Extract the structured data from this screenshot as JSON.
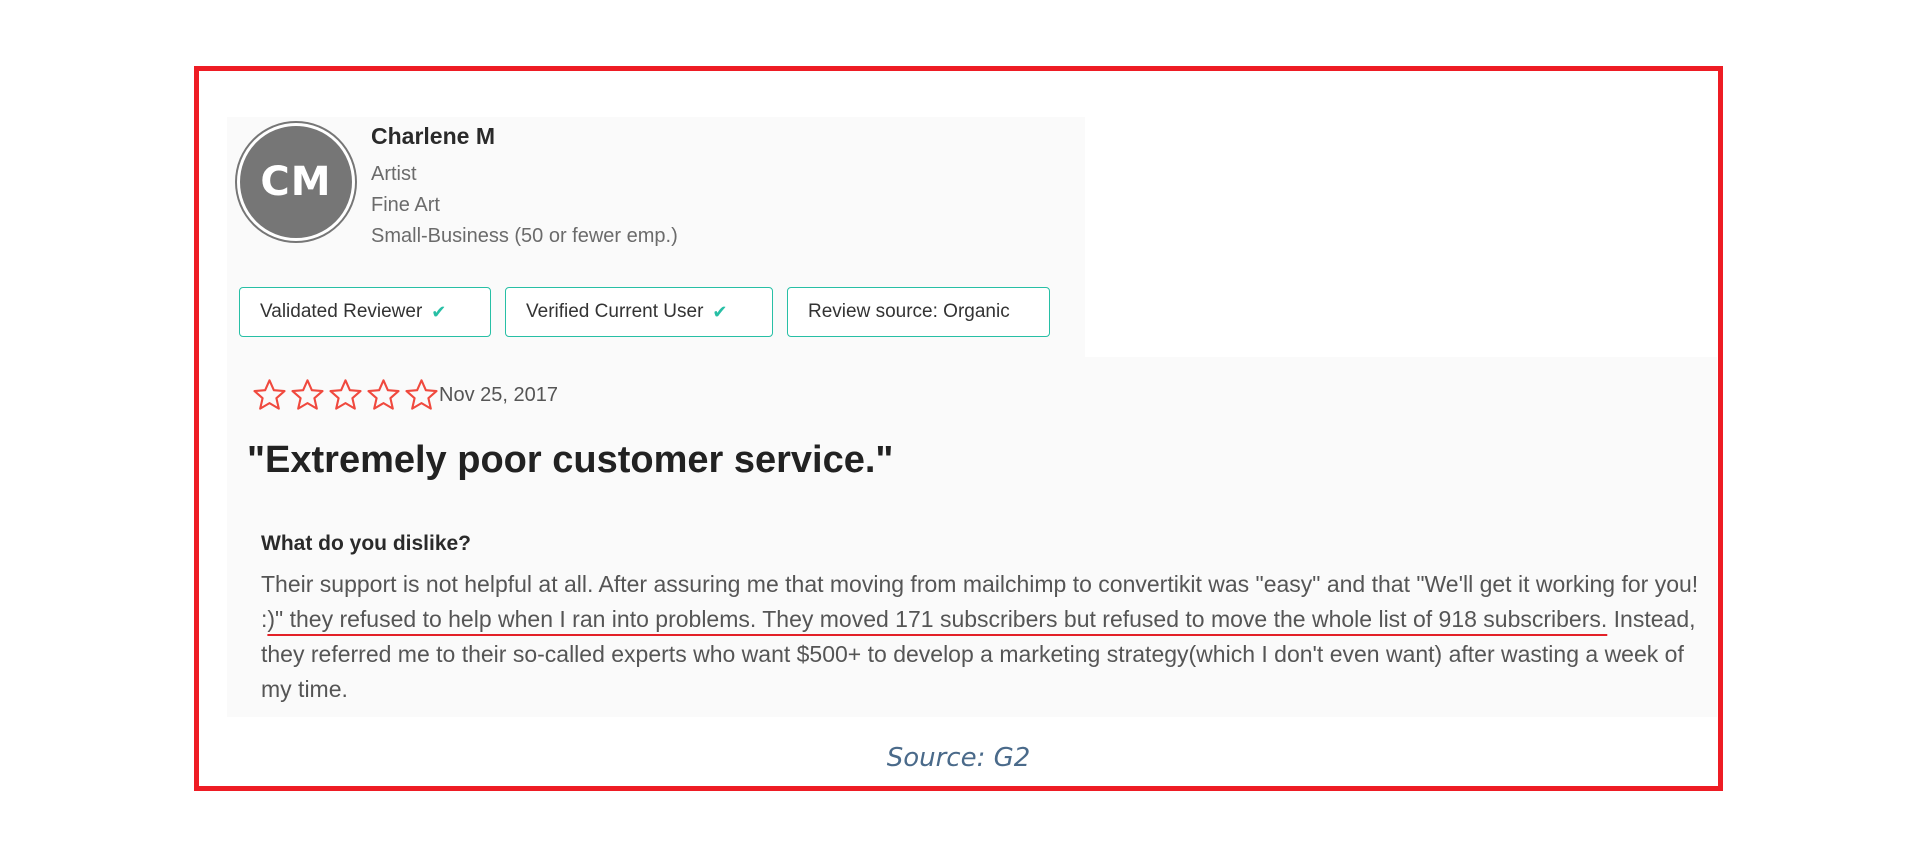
{
  "reviewer": {
    "initials": "CM",
    "name": "Charlene M",
    "role": "Artist",
    "industry": "Fine Art",
    "company_size": "Small-Business (50 or fewer emp.)"
  },
  "badges": [
    {
      "label": "Validated Reviewer",
      "icon": "check-icon"
    },
    {
      "label": "Verified Current User",
      "icon": "check-icon"
    },
    {
      "label": "Review source: Organic",
      "icon": ""
    }
  ],
  "review": {
    "rating": 0,
    "rating_max": 5,
    "date": "Nov 25, 2017",
    "title": "\"Extremely poor customer service.\"",
    "question": "What do you dislike?",
    "answer_part1": "Their support is not helpful at all. After assuring me that moving from mailchimp to convertikit was \"easy\" and that \"We'll get it working for you! :",
    "answer_highlight": ")\" they refused to help when I ran into problems. They moved 171 subscribers but refused to move the whole list of 918 subscribers.",
    "answer_part2": " Instead, they referred me to their so-called experts who want $500+ to develop a marketing strategy(which I don't even want) after wasting a week of my time."
  },
  "source": "Source: G2",
  "colors": {
    "frame": "#ee1c24",
    "badge_border": "#27bfa5",
    "star_outline": "#f0493e",
    "underline": "#e32027",
    "avatar": "#767676"
  }
}
